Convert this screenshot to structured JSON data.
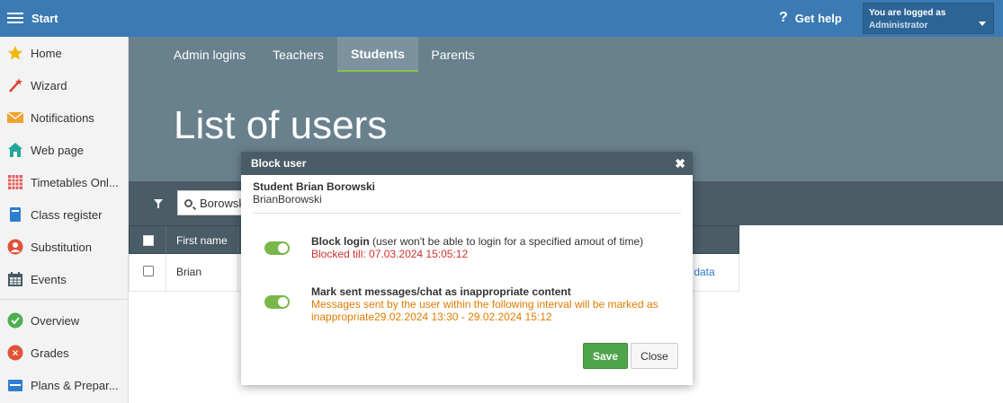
{
  "topbar": {
    "start_label": "Start",
    "help_label": "Get help",
    "logged_label": "You are logged as",
    "user_role": "Administrator"
  },
  "sidebar": {
    "items": [
      {
        "label": "Home",
        "icon": "star-icon"
      },
      {
        "label": "Wizard",
        "icon": "wand-icon"
      },
      {
        "label": "Notifications",
        "icon": "envelope-icon"
      },
      {
        "label": "Web page",
        "icon": "house-icon"
      },
      {
        "label": "Timetables Onl...",
        "icon": "calendar-grid-icon"
      },
      {
        "label": "Class register",
        "icon": "book-icon"
      },
      {
        "label": "Substitution",
        "icon": "person-icon"
      },
      {
        "label": "Events",
        "icon": "calendar-icon"
      },
      {
        "label": "Overview",
        "icon": "check-circle-icon"
      },
      {
        "label": "Grades",
        "icon": "grades-icon"
      },
      {
        "label": "Plans & Prepar...",
        "icon": "plans-icon"
      }
    ]
  },
  "tabs": [
    {
      "label": "Admin logins",
      "active": false
    },
    {
      "label": "Teachers",
      "active": false
    },
    {
      "label": "Students",
      "active": true
    },
    {
      "label": "Parents",
      "active": false
    }
  ],
  "page_title": "List of users",
  "search": {
    "value": "Borowski"
  },
  "table": {
    "header_first_name": "First name",
    "row_first_name": "Brian",
    "row_link": "r data"
  },
  "modal": {
    "title": "Block user",
    "close_glyph": "✖",
    "student_name": "Student Brian Borowski",
    "student_login": "BrianBorowski",
    "option1": {
      "title": "Block login",
      "desc": "(user won't be able to login for a specified amout of time)",
      "status": "Blocked till: 07.03.2024 15:05:12",
      "enabled": true
    },
    "option2": {
      "title": "Mark sent messages/chat as inappropriate content",
      "status": "Messages sent by the user within the following interval will be marked as inappropriate29.02.2024 13:30 - 29.02.2024 15:12",
      "enabled": true
    },
    "save_label": "Save",
    "close_label": "Close"
  },
  "colors": {
    "topbar": "#3b7ab3",
    "header": "#69808d",
    "dark_bar": "#4a5c66",
    "toggle_on": "#79b74a",
    "save": "#4fa34b",
    "danger": "#d0312d",
    "warning": "#e07b00"
  }
}
